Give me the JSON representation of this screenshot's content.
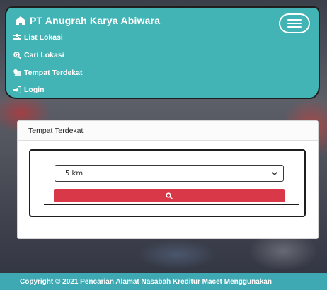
{
  "navbar": {
    "brand": "PT Anugrah Karya Abiwara",
    "brand_icon": "home-icon",
    "menu": [
      {
        "label": "List Lokasi",
        "icon": "list-icon"
      },
      {
        "label": "Cari Lokasi",
        "icon": "search-plus-icon"
      },
      {
        "label": "Tempat Terdekat",
        "icon": "map-marker-icon"
      },
      {
        "label": "Login",
        "icon": "sign-in-icon"
      }
    ],
    "color": "#43b4b5"
  },
  "card": {
    "title": "Tempat Terdekat",
    "select_value": "5 km",
    "button_color": "#d83848",
    "button_icon": "search-icon"
  },
  "footer": {
    "text": "Copyright © 2021 Pencarian Alamat Nasabah Kreditur Macet Menggunakan",
    "color": "#3fa9b3"
  }
}
